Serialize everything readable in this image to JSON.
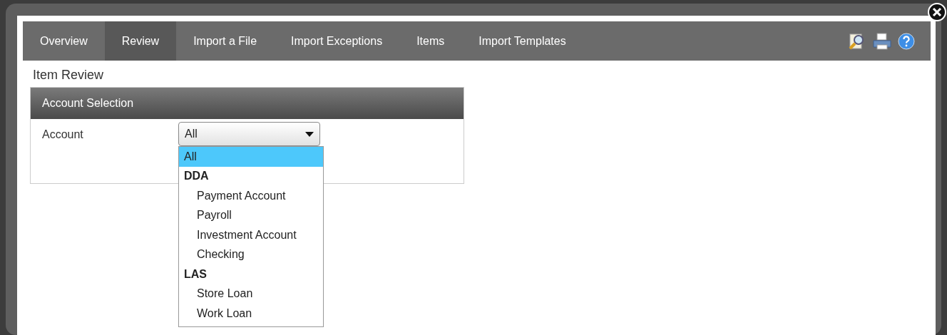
{
  "tabs": [
    {
      "label": "Overview",
      "selected": false
    },
    {
      "label": "Review",
      "selected": true
    },
    {
      "label": "Import a File",
      "selected": false
    },
    {
      "label": "Import Exceptions",
      "selected": false
    },
    {
      "label": "Items",
      "selected": false
    },
    {
      "label": "Import Templates",
      "selected": false
    }
  ],
  "page_title": "Item Review",
  "section": {
    "title": "Account Selection",
    "field_label": "Account",
    "select_value": "All",
    "options": [
      {
        "kind": "option",
        "label": "All",
        "selected": true
      },
      {
        "kind": "group",
        "label": "DDA"
      },
      {
        "kind": "option",
        "label": "Payment Account",
        "selected": false
      },
      {
        "kind": "option",
        "label": "Payroll",
        "selected": false
      },
      {
        "kind": "option",
        "label": "Investment Account",
        "selected": false
      },
      {
        "kind": "option",
        "label": "Checking",
        "selected": false
      },
      {
        "kind": "group",
        "label": "LAS"
      },
      {
        "kind": "option",
        "label": "Store Loan",
        "selected": false
      },
      {
        "kind": "option",
        "label": "Work Loan",
        "selected": false
      }
    ]
  }
}
